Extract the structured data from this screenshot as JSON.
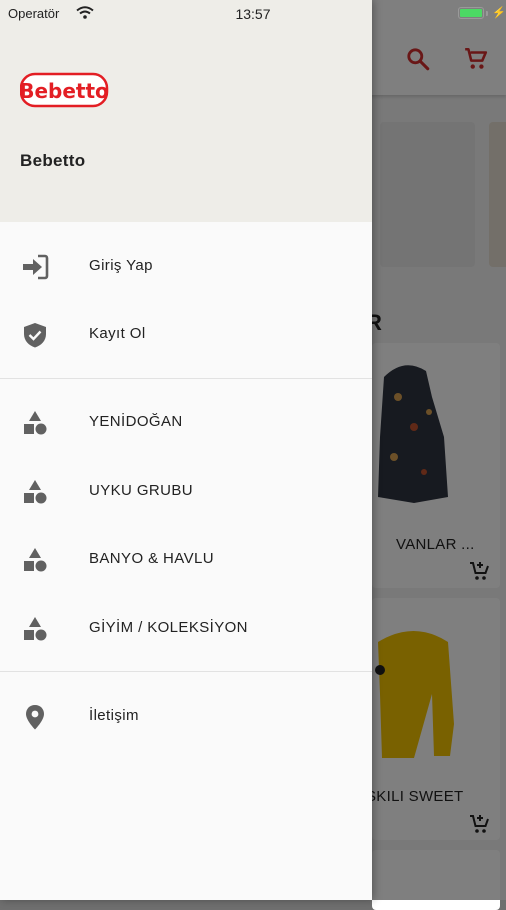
{
  "status_bar": {
    "carrier": "Operatör",
    "time": "13:57"
  },
  "drawer": {
    "store_name": "Bebetto",
    "account_items": [
      {
        "label": "Giriş Yap",
        "icon": "login-icon"
      },
      {
        "label": "Kayıt Ol",
        "icon": "shield-check-icon"
      }
    ],
    "category_items": [
      {
        "label": "YENİDOĞAN",
        "icon": "category-shapes-icon"
      },
      {
        "label": "UYKU GRUBU",
        "icon": "category-shapes-icon"
      },
      {
        "label": "BANYO & HAVLU",
        "icon": "category-shapes-icon"
      },
      {
        "label": "GİYİM / KOLEKSİYON",
        "icon": "category-shapes-icon"
      }
    ],
    "contact_item": {
      "label": "İletişim",
      "icon": "location-pin-icon"
    }
  },
  "background": {
    "section_heading_fragment": "R",
    "products": [
      {
        "title_fragment": "VANLAR ..."
      },
      {
        "title_fragment": "SKILI SWEET"
      }
    ]
  },
  "colors": {
    "brand_red": "#e31e24",
    "appbar_icon": "#d32f2f",
    "drawer_header_bg": "#eeede8",
    "icon_grey": "#616161"
  }
}
